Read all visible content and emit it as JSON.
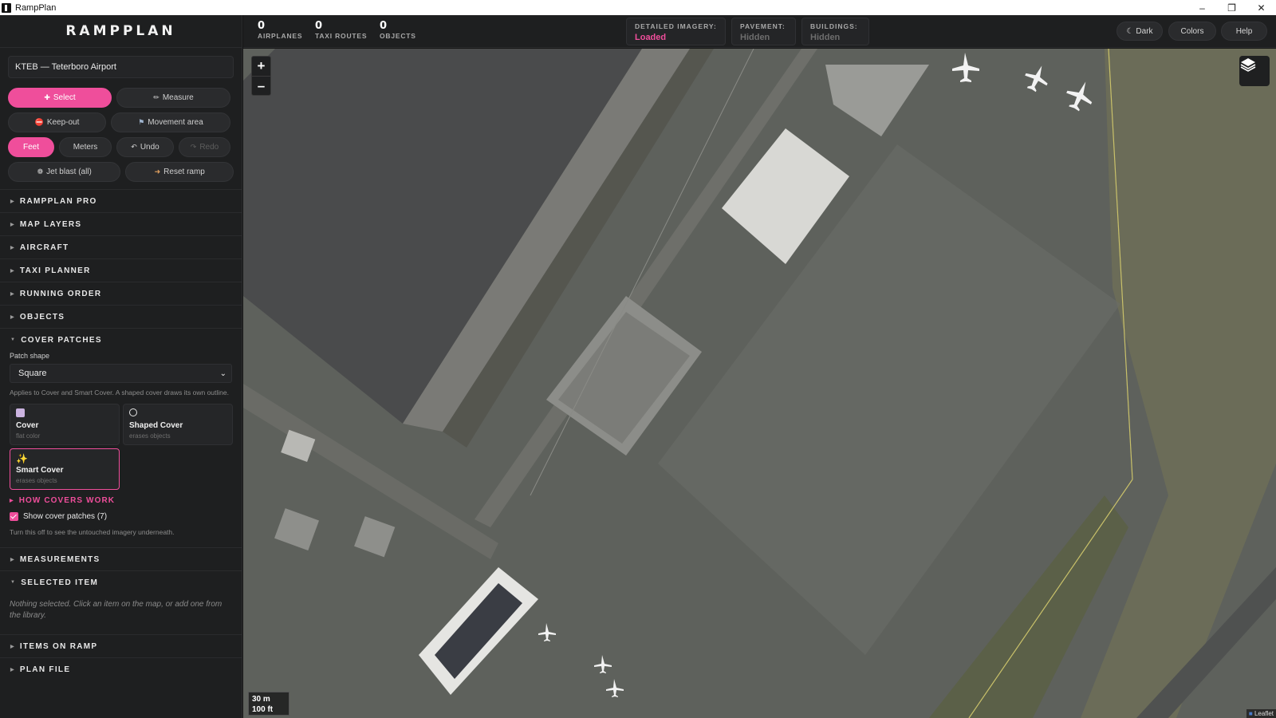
{
  "window": {
    "title": "RampPlan"
  },
  "sidebar": {
    "logo": "RAMPPLAN",
    "airport": "KTEB — Teterboro Airport",
    "tools": {
      "select": "Select",
      "measure": "Measure",
      "keepout": "Keep-out",
      "movement": "Movement area",
      "feet": "Feet",
      "meters": "Meters",
      "undo": "Undo",
      "redo": "Redo",
      "jetblast": "Jet blast (all)",
      "reset": "Reset ramp"
    },
    "sections": {
      "pro": "RAMPPLAN PRO",
      "layers": "MAP LAYERS",
      "aircraft": "AIRCRAFT",
      "taxi": "TAXI PLANNER",
      "order": "RUNNING ORDER",
      "objects": "OBJECTS",
      "cover": "COVER PATCHES",
      "measurements": "MEASUREMENTS",
      "selected": "SELECTED ITEM",
      "items": "ITEMS ON RAMP",
      "planfile": "PLAN FILE"
    },
    "cover_patches": {
      "shape_label": "Patch shape",
      "shape_value": "Square",
      "help": "Applies to Cover and Smart Cover. A shaped cover draws its own outline.",
      "cards": [
        {
          "title": "Cover",
          "sub": "flat color"
        },
        {
          "title": "Shaped Cover",
          "sub": "erases objects"
        },
        {
          "title": "Smart Cover",
          "sub": "erases objects"
        }
      ],
      "how_link": "HOW COVERS WORK",
      "show_label": "Show cover patches (7)",
      "show_checked": true,
      "show_help": "Turn this off to see the untouched imagery underneath."
    },
    "selected_note": "Nothing selected. Click an item on the map, or add one from the library."
  },
  "topbar": {
    "stats": [
      {
        "num": "0",
        "cap": "AIRPLANES"
      },
      {
        "num": "0",
        "cap": "TAXI ROUTES"
      },
      {
        "num": "0",
        "cap": "OBJECTS"
      }
    ],
    "status": {
      "imagery_label": "DETAILED IMAGERY:",
      "imagery_value": "Loaded",
      "pavement_label": "PAVEMENT:",
      "pavement_value": "Hidden",
      "buildings_label": "BUILDINGS:",
      "buildings_value": "Hidden"
    },
    "buttons": {
      "dark": "Dark",
      "colors": "Colors",
      "help": "Help"
    }
  },
  "map": {
    "zoom_in": "+",
    "zoom_out": "–",
    "scale_m": "30 m",
    "scale_ft": "100 ft",
    "attribution": "Leaflet"
  },
  "colors": {
    "accent": "#ef4e9b",
    "panel": "#1e1f20"
  },
  "icons": [
    "select-icon",
    "measure-icon",
    "keepout-icon",
    "movement-icon",
    "undo-icon",
    "redo-icon",
    "jetblast-icon",
    "reset-icon",
    "layers-icon",
    "moon-icon"
  ]
}
